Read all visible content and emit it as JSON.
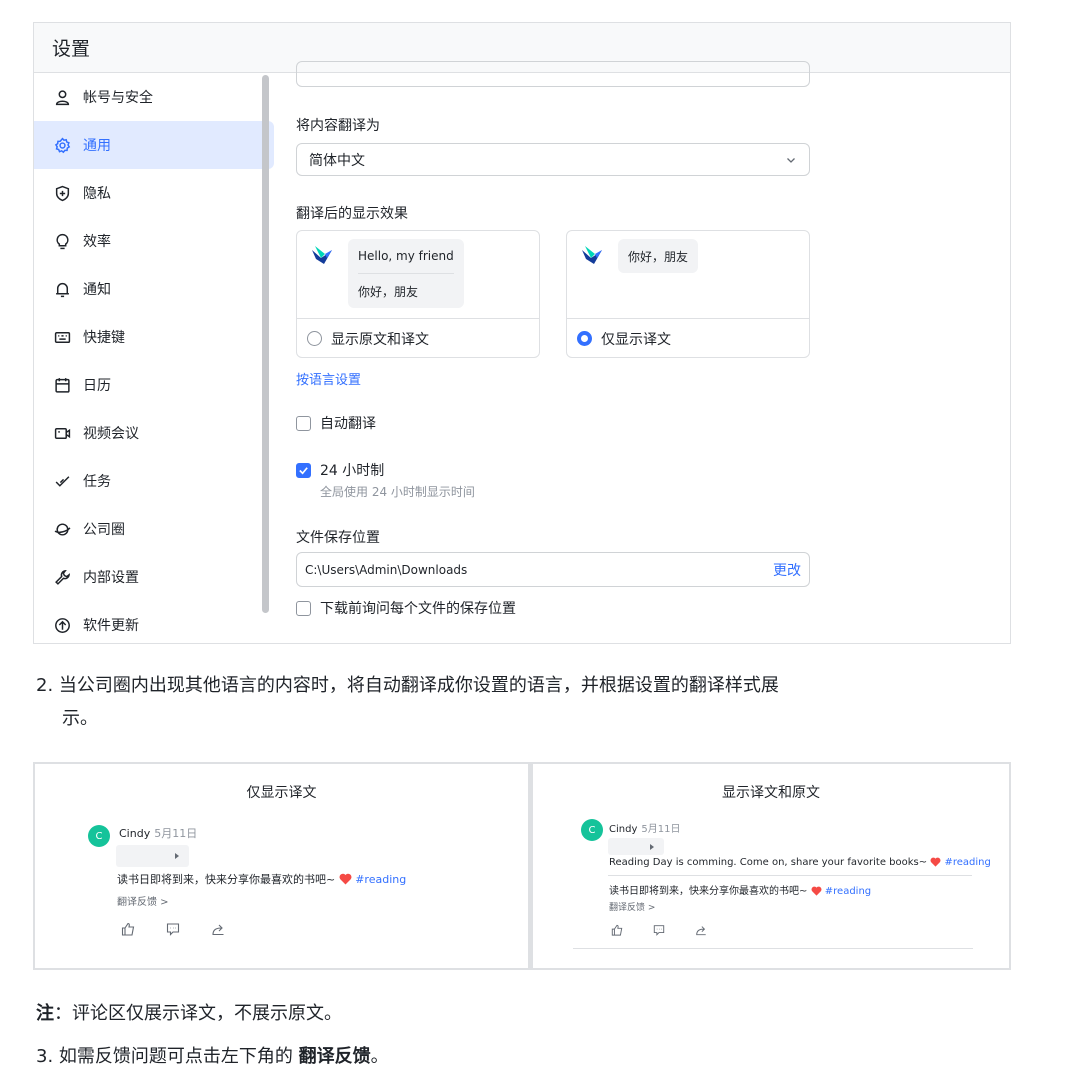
{
  "window": {
    "title": "设置"
  },
  "sidebar": {
    "items": [
      {
        "label": "帐号与安全",
        "icon": "user-icon"
      },
      {
        "label": "通用",
        "icon": "gear-icon",
        "active": true
      },
      {
        "label": "隐私",
        "icon": "shield-icon"
      },
      {
        "label": "效率",
        "icon": "lightbulb-icon"
      },
      {
        "label": "通知",
        "icon": "bell-icon"
      },
      {
        "label": "快捷键",
        "icon": "keyboard-icon"
      },
      {
        "label": "日历",
        "icon": "calendar-icon"
      },
      {
        "label": "视频会议",
        "icon": "video-icon"
      },
      {
        "label": "任务",
        "icon": "task-icon"
      },
      {
        "label": "公司圈",
        "icon": "planet-icon"
      },
      {
        "label": "内部设置",
        "icon": "wrench-icon"
      },
      {
        "label": "软件更新",
        "icon": "update-icon"
      }
    ]
  },
  "general": {
    "translate_label": "将内容翻译为",
    "translate_value": "简体中文",
    "display_label": "翻译后的显示效果",
    "card_both": {
      "original": "Hello, my friend",
      "translated": "你好，朋友",
      "option": "显示原文和译文",
      "selected": false
    },
    "card_only": {
      "translated": "你好，朋友",
      "option": "仅显示译文",
      "selected": true
    },
    "language_link": "按语言设置",
    "auto_translate": {
      "label": "自动翻译",
      "checked": false
    },
    "hour24": {
      "label": "24 小时制",
      "checked": true,
      "hint": "全局使用 24 小时制显示时间"
    },
    "save_label": "文件保存位置",
    "save_path": "C:\\Users\\Admin\\Downloads",
    "change_label": "更改",
    "ask_each": {
      "label": "下载前询问每个文件的保存位置",
      "checked": false
    }
  },
  "doc": {
    "step2_line1": "2. 当公司圈内出现其他语言的内容时，将自动翻译成你设置的语言，并根据设置的翻译样式展",
    "step2_line2": "示。",
    "note_bold": "注",
    "note_text": "：评论区仅展示译文，不展示原文。",
    "step3_text": "3. 如需反馈问题可点击左下角的 ",
    "step3_bold": "翻译反馈",
    "step3_end": "。"
  },
  "examples": {
    "left": {
      "title": "仅显示译文",
      "avatar": "C",
      "name": "Cindy",
      "date": "5月11日",
      "text": "读书日即将到来，快来分享你最喜欢的书吧~",
      "tag": "#reading",
      "feedback": "翻译反馈 >"
    },
    "right": {
      "title": "显示译文和原文",
      "avatar": "C",
      "name": "Cindy",
      "date": "5月11日",
      "original": "Reading Day is comming. Come on, share your favorite books~",
      "text": "读书日即将到来，快来分享你最喜欢的书吧~",
      "tag": "#reading",
      "feedback": "翻译反馈 >"
    }
  },
  "colors": {
    "accent": "#3370ff",
    "active_bg": "#e1eaff",
    "avatar": "#15c39a",
    "heart": "#f54a45"
  }
}
